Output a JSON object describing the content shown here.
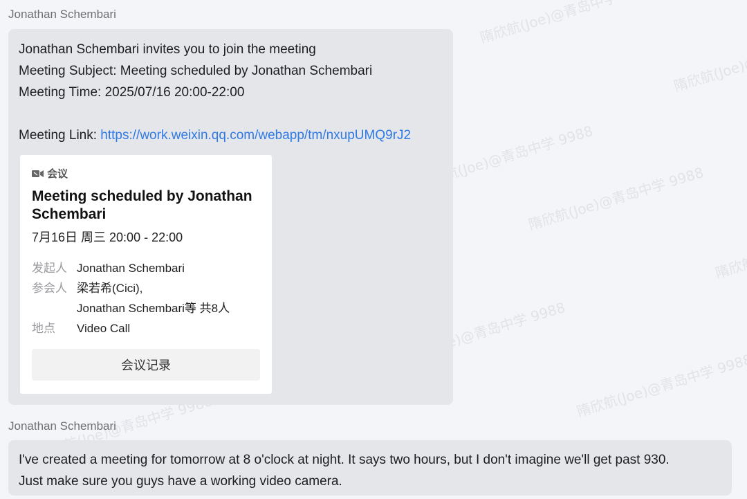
{
  "message1": {
    "sender": "Jonathan Schembari",
    "line1": "Jonathan Schembari invites you to join the meeting",
    "line2": "Meeting Subject: Meeting scheduled by Jonathan Schembari",
    "line3": "Meeting Time: 2025/07/16 20:00-22:00",
    "link_label": "Meeting Link: ",
    "link_url": "https://work.weixin.qq.com/webapp/tm/nxupUMQ9rJ2",
    "card": {
      "icon": "video-camera-icon",
      "type_label": "会议",
      "title": "Meeting scheduled by Jonathan Schembari",
      "time": "7月16日 周三 20:00 - 22:00",
      "organizer_label": "发起人",
      "organizer": "Jonathan Schembari",
      "attendees_label": "参会人",
      "attendees_line1": "梁若希(Cici),",
      "attendees_line2": "Jonathan Schembari等 共8人",
      "location_label": "地点",
      "location": "Video Call",
      "record_button": "会议记录"
    }
  },
  "message2": {
    "sender": "Jonathan Schembari",
    "line1": "I've created a meeting for tomorrow at 8 o'clock at night.  It says two hours, but I don't imagine we'll get past 930.",
    "line2": "Just make sure you guys have a working video camera."
  },
  "watermark": "隋欣航(Joe)@青岛中学 9988",
  "colors": {
    "link": "#2f7ae5",
    "bubble": "#e4e6ea",
    "background": "#f4f5f9"
  }
}
